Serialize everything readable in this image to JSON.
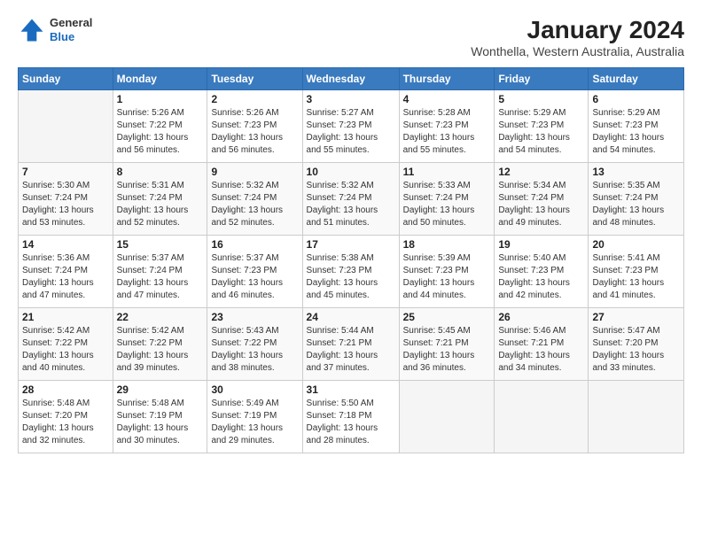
{
  "header": {
    "logo": {
      "general": "General",
      "blue": "Blue"
    },
    "title": "January 2024",
    "subtitle": "Wonthella, Western Australia, Australia"
  },
  "calendar": {
    "days_of_week": [
      "Sunday",
      "Monday",
      "Tuesday",
      "Wednesday",
      "Thursday",
      "Friday",
      "Saturday"
    ],
    "weeks": [
      [
        {
          "num": "",
          "info": ""
        },
        {
          "num": "1",
          "info": "Sunrise: 5:26 AM\nSunset: 7:22 PM\nDaylight: 13 hours\nand 56 minutes."
        },
        {
          "num": "2",
          "info": "Sunrise: 5:26 AM\nSunset: 7:23 PM\nDaylight: 13 hours\nand 56 minutes."
        },
        {
          "num": "3",
          "info": "Sunrise: 5:27 AM\nSunset: 7:23 PM\nDaylight: 13 hours\nand 55 minutes."
        },
        {
          "num": "4",
          "info": "Sunrise: 5:28 AM\nSunset: 7:23 PM\nDaylight: 13 hours\nand 55 minutes."
        },
        {
          "num": "5",
          "info": "Sunrise: 5:29 AM\nSunset: 7:23 PM\nDaylight: 13 hours\nand 54 minutes."
        },
        {
          "num": "6",
          "info": "Sunrise: 5:29 AM\nSunset: 7:23 PM\nDaylight: 13 hours\nand 54 minutes."
        }
      ],
      [
        {
          "num": "7",
          "info": "Sunrise: 5:30 AM\nSunset: 7:24 PM\nDaylight: 13 hours\nand 53 minutes."
        },
        {
          "num": "8",
          "info": "Sunrise: 5:31 AM\nSunset: 7:24 PM\nDaylight: 13 hours\nand 52 minutes."
        },
        {
          "num": "9",
          "info": "Sunrise: 5:32 AM\nSunset: 7:24 PM\nDaylight: 13 hours\nand 52 minutes."
        },
        {
          "num": "10",
          "info": "Sunrise: 5:32 AM\nSunset: 7:24 PM\nDaylight: 13 hours\nand 51 minutes."
        },
        {
          "num": "11",
          "info": "Sunrise: 5:33 AM\nSunset: 7:24 PM\nDaylight: 13 hours\nand 50 minutes."
        },
        {
          "num": "12",
          "info": "Sunrise: 5:34 AM\nSunset: 7:24 PM\nDaylight: 13 hours\nand 49 minutes."
        },
        {
          "num": "13",
          "info": "Sunrise: 5:35 AM\nSunset: 7:24 PM\nDaylight: 13 hours\nand 48 minutes."
        }
      ],
      [
        {
          "num": "14",
          "info": "Sunrise: 5:36 AM\nSunset: 7:24 PM\nDaylight: 13 hours\nand 47 minutes."
        },
        {
          "num": "15",
          "info": "Sunrise: 5:37 AM\nSunset: 7:24 PM\nDaylight: 13 hours\nand 47 minutes."
        },
        {
          "num": "16",
          "info": "Sunrise: 5:37 AM\nSunset: 7:23 PM\nDaylight: 13 hours\nand 46 minutes."
        },
        {
          "num": "17",
          "info": "Sunrise: 5:38 AM\nSunset: 7:23 PM\nDaylight: 13 hours\nand 45 minutes."
        },
        {
          "num": "18",
          "info": "Sunrise: 5:39 AM\nSunset: 7:23 PM\nDaylight: 13 hours\nand 44 minutes."
        },
        {
          "num": "19",
          "info": "Sunrise: 5:40 AM\nSunset: 7:23 PM\nDaylight: 13 hours\nand 42 minutes."
        },
        {
          "num": "20",
          "info": "Sunrise: 5:41 AM\nSunset: 7:23 PM\nDaylight: 13 hours\nand 41 minutes."
        }
      ],
      [
        {
          "num": "21",
          "info": "Sunrise: 5:42 AM\nSunset: 7:22 PM\nDaylight: 13 hours\nand 40 minutes."
        },
        {
          "num": "22",
          "info": "Sunrise: 5:42 AM\nSunset: 7:22 PM\nDaylight: 13 hours\nand 39 minutes."
        },
        {
          "num": "23",
          "info": "Sunrise: 5:43 AM\nSunset: 7:22 PM\nDaylight: 13 hours\nand 38 minutes."
        },
        {
          "num": "24",
          "info": "Sunrise: 5:44 AM\nSunset: 7:21 PM\nDaylight: 13 hours\nand 37 minutes."
        },
        {
          "num": "25",
          "info": "Sunrise: 5:45 AM\nSunset: 7:21 PM\nDaylight: 13 hours\nand 36 minutes."
        },
        {
          "num": "26",
          "info": "Sunrise: 5:46 AM\nSunset: 7:21 PM\nDaylight: 13 hours\nand 34 minutes."
        },
        {
          "num": "27",
          "info": "Sunrise: 5:47 AM\nSunset: 7:20 PM\nDaylight: 13 hours\nand 33 minutes."
        }
      ],
      [
        {
          "num": "28",
          "info": "Sunrise: 5:48 AM\nSunset: 7:20 PM\nDaylight: 13 hours\nand 32 minutes."
        },
        {
          "num": "29",
          "info": "Sunrise: 5:48 AM\nSunset: 7:19 PM\nDaylight: 13 hours\nand 30 minutes."
        },
        {
          "num": "30",
          "info": "Sunrise: 5:49 AM\nSunset: 7:19 PM\nDaylight: 13 hours\nand 29 minutes."
        },
        {
          "num": "31",
          "info": "Sunrise: 5:50 AM\nSunset: 7:18 PM\nDaylight: 13 hours\nand 28 minutes."
        },
        {
          "num": "",
          "info": ""
        },
        {
          "num": "",
          "info": ""
        },
        {
          "num": "",
          "info": ""
        }
      ]
    ]
  }
}
